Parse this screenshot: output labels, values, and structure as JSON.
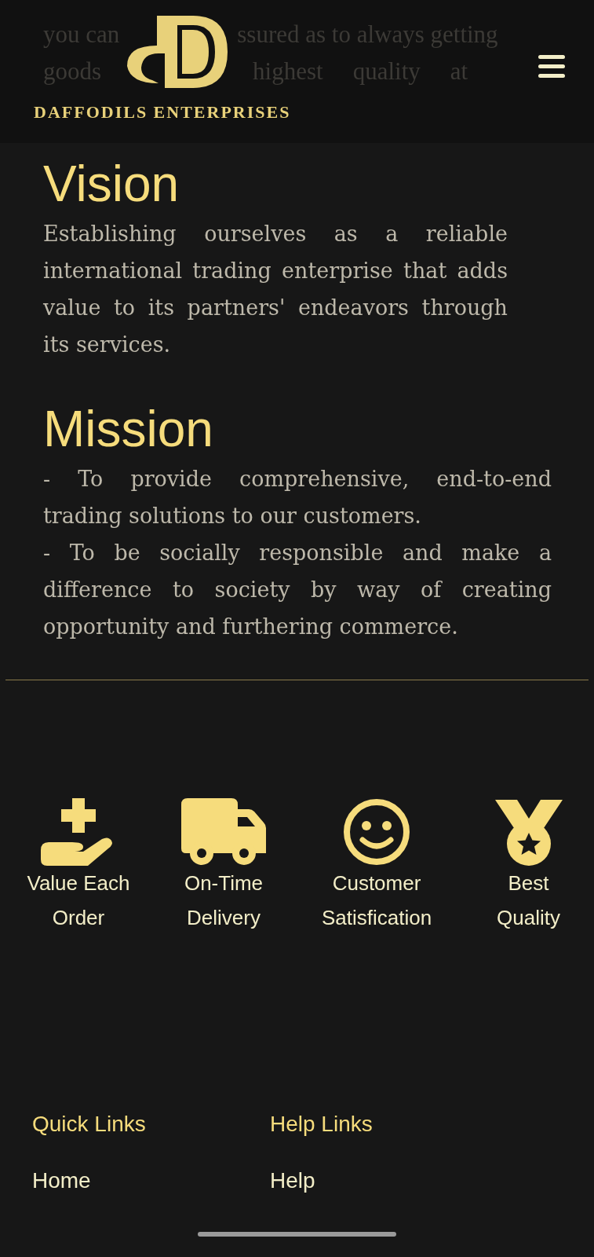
{
  "header": {
    "behind_text": [
      "you can",
      "ssured as to always getting",
      "goods",
      "highest",
      "quality",
      "at"
    ],
    "brand": "DAFFODILS ENTERPRISES"
  },
  "sections": [
    {
      "heading": "Vision",
      "paragraphs": [
        "Establishing ourselves as a reliable international trading enterprise that adds value to its partners' endeavors through its services."
      ]
    },
    {
      "heading": "Mission",
      "paragraphs": [
        "- To provide comprehensive, end-to-end trading solutions to our customers.",
        "- To be socially responsible and make a difference to society by way of creating opportunity and furthering commerce."
      ]
    }
  ],
  "features": [
    {
      "kind": "hand",
      "lines": [
        "Value Each",
        "Order"
      ]
    },
    {
      "kind": "truck",
      "lines": [
        "On-Time",
        "Delivery"
      ]
    },
    {
      "kind": "smile",
      "lines": [
        "Customer",
        "Satisfication"
      ]
    },
    {
      "kind": "medal",
      "lines": [
        "Best",
        "Quality"
      ]
    }
  ],
  "footer": [
    {
      "title": "Quick Links",
      "links": [
        "Home"
      ]
    },
    {
      "title": "Help Links",
      "links": [
        "Help"
      ]
    }
  ]
}
